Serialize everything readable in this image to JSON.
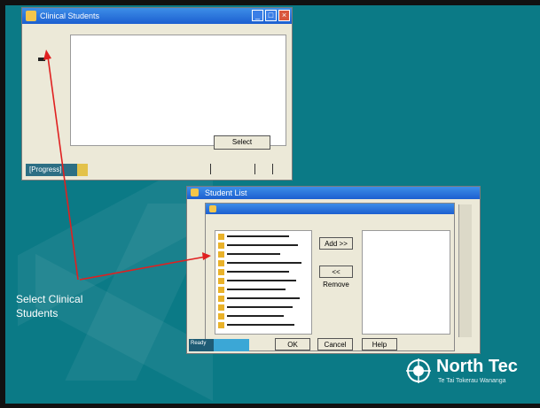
{
  "caption": {
    "line1": "Select Clinical",
    "line2": "Students"
  },
  "logo": {
    "name": "North Tec",
    "tagline": "Te Tai Tokerau Wananga"
  },
  "colors": {
    "slide_background": "#0b7a86",
    "window_face": "#ece9d8",
    "arrow": "#e02020",
    "caption_text": "#ffffff"
  },
  "windows": {
    "top": {
      "title": "Clinical Students",
      "buttons": {
        "ok": "Select"
      },
      "status": "[Progress]",
      "icon": "folder-icon"
    },
    "bottom": {
      "title": "Student List",
      "buttons": {
        "add": "Add >>",
        "remove": "<< Remove",
        "ok": "OK",
        "cancel": "Cancel",
        "help": "Help"
      },
      "status": "Ready",
      "icon": "folder-icon"
    }
  }
}
